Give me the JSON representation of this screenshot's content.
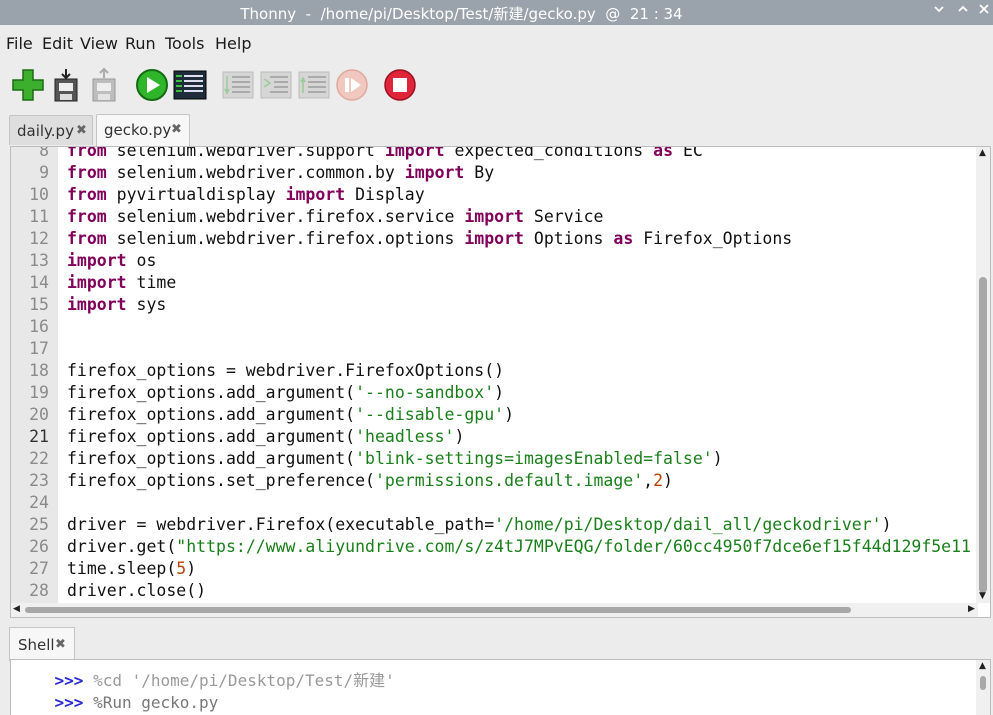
{
  "window": {
    "title": "Thonny  -  /home/pi/Desktop/Test/新建/gecko.py  @  21 : 34",
    "controls": [
      "chevron-down-icon",
      "chevron-up-icon",
      "close-icon"
    ]
  },
  "menu": [
    "File",
    "Edit",
    "View",
    "Run",
    "Tools",
    "Help"
  ],
  "toolbar": [
    "new-file",
    "load",
    "save",
    "run",
    "debug",
    "step-over",
    "step-into",
    "step-out",
    "resume",
    "stop"
  ],
  "editor_tabs": [
    {
      "name": "daily.py",
      "close": "✖"
    },
    {
      "name": "gecko.py",
      "close": "✖"
    }
  ],
  "editor": {
    "current_line": "21",
    "lines": [
      {
        "n": "8",
        "t": [
          [
            "kw",
            "from"
          ],
          [
            "p",
            " selenium.webdriver.support "
          ],
          [
            "kw",
            "import"
          ],
          [
            "p",
            " expected_conditions "
          ],
          [
            "kw",
            "as"
          ],
          [
            "p",
            " EC"
          ]
        ]
      },
      {
        "n": "9",
        "t": [
          [
            "kw",
            "from"
          ],
          [
            "p",
            " selenium.webdriver.common.by "
          ],
          [
            "kw",
            "import"
          ],
          [
            "p",
            " By"
          ]
        ]
      },
      {
        "n": "10",
        "t": [
          [
            "kw",
            "from"
          ],
          [
            "p",
            " pyvirtualdisplay "
          ],
          [
            "kw",
            "import"
          ],
          [
            "p",
            " Display"
          ]
        ]
      },
      {
        "n": "11",
        "t": [
          [
            "kw",
            "from"
          ],
          [
            "p",
            " selenium.webdriver.firefox.service "
          ],
          [
            "kw",
            "import"
          ],
          [
            "p",
            " Service"
          ]
        ]
      },
      {
        "n": "12",
        "t": [
          [
            "kw",
            "from"
          ],
          [
            "p",
            " selenium.webdriver.firefox.options "
          ],
          [
            "kw",
            "import"
          ],
          [
            "p",
            " Options "
          ],
          [
            "kw",
            "as"
          ],
          [
            "p",
            " Firefox_Options"
          ]
        ]
      },
      {
        "n": "13",
        "t": [
          [
            "kw",
            "import"
          ],
          [
            "p",
            " os"
          ]
        ]
      },
      {
        "n": "14",
        "t": [
          [
            "kw",
            "import"
          ],
          [
            "p",
            " time"
          ]
        ]
      },
      {
        "n": "15",
        "t": [
          [
            "kw",
            "import"
          ],
          [
            "p",
            " sys"
          ]
        ]
      },
      {
        "n": "16",
        "t": []
      },
      {
        "n": "17",
        "t": []
      },
      {
        "n": "18",
        "t": [
          [
            "p",
            "firefox_options = webdriver.FirefoxOptions()"
          ]
        ]
      },
      {
        "n": "19",
        "t": [
          [
            "p",
            "firefox_options.add_argument("
          ],
          [
            "str",
            "'--no-sandbox'"
          ],
          [
            "p",
            ")"
          ]
        ]
      },
      {
        "n": "20",
        "t": [
          [
            "p",
            "firefox_options.add_argument("
          ],
          [
            "str",
            "'--disable-gpu'"
          ],
          [
            "p",
            ")"
          ]
        ]
      },
      {
        "n": "21",
        "t": [
          [
            "p",
            "firefox_options.add_argument("
          ],
          [
            "str",
            "'headless'"
          ],
          [
            "p",
            ")"
          ]
        ]
      },
      {
        "n": "22",
        "t": [
          [
            "p",
            "firefox_options.add_argument("
          ],
          [
            "str",
            "'blink-settings=imagesEnabled=false'"
          ],
          [
            "p",
            ")"
          ]
        ]
      },
      {
        "n": "23",
        "t": [
          [
            "p",
            "firefox_options.set_preference("
          ],
          [
            "str",
            "'permissions.default.image'"
          ],
          [
            "p",
            ","
          ],
          [
            "num",
            "2"
          ],
          [
            "p",
            ")"
          ]
        ]
      },
      {
        "n": "24",
        "t": []
      },
      {
        "n": "25",
        "t": [
          [
            "p",
            "driver = webdriver.Firefox(executable_path="
          ],
          [
            "str",
            "'/home/pi/Desktop/dail_all/geckodriver'"
          ],
          [
            "p",
            ")"
          ]
        ]
      },
      {
        "n": "26",
        "t": [
          [
            "p",
            "driver.get("
          ],
          [
            "str",
            "\"https://www.aliyundrive.com/s/z4tJ7MPvEQG/folder/60cc4950f7dce6ef15f44d129f5e11"
          ]
        ]
      },
      {
        "n": "27",
        "t": [
          [
            "p",
            "time.sleep("
          ],
          [
            "num",
            "5"
          ],
          [
            "p",
            ")"
          ]
        ]
      },
      {
        "n": "28",
        "t": [
          [
            "p",
            "driver.close()"
          ]
        ]
      }
    ]
  },
  "shell": {
    "tab": "Shell",
    "close": "✖",
    "lines": [
      {
        "prompt": ">>>",
        "cmd": " %cd '/home/pi/Desktop/Test/新建'"
      },
      {
        "prompt": ">>>",
        "cmd": " %Run gecko.py"
      }
    ]
  },
  "colors": {
    "title_bg": "#9aa3ab",
    "keyword": "#80005a",
    "string": "#1a7f1a",
    "number": "#b8400a",
    "prompt": "#2a2ad4"
  }
}
